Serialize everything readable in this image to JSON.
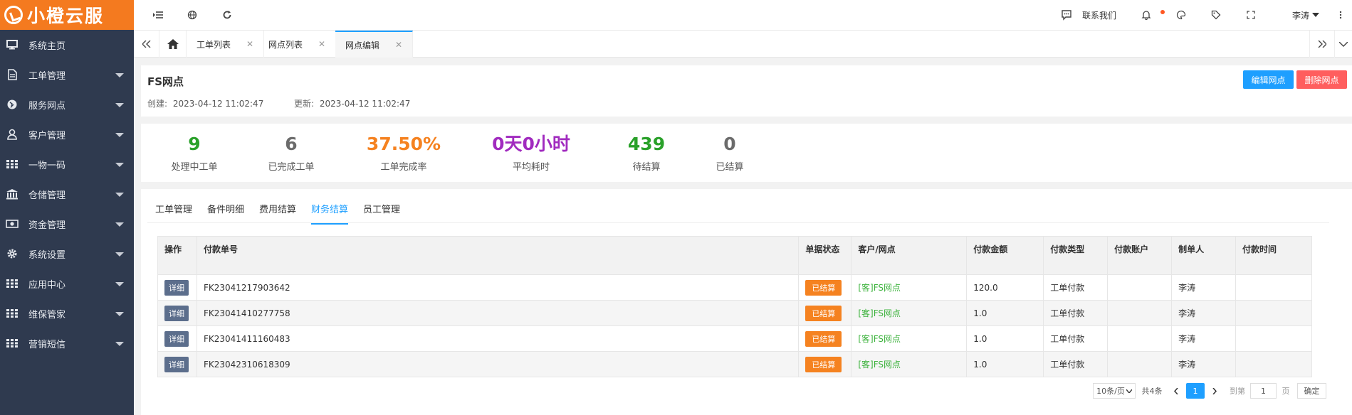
{
  "brand": {
    "name": "小橙云服"
  },
  "sidebar": {
    "items": [
      {
        "label": "系统主页",
        "icon": "monitor-icon",
        "has_arrow": false
      },
      {
        "label": "工单管理",
        "icon": "document-icon",
        "has_arrow": true
      },
      {
        "label": "服务网点",
        "icon": "globe-icon",
        "has_arrow": true
      },
      {
        "label": "客户管理",
        "icon": "user-icon",
        "has_arrow": true
      },
      {
        "label": "一物一码",
        "icon": "grid-icon",
        "has_arrow": true
      },
      {
        "label": "仓储管理",
        "icon": "warehouse-icon",
        "has_arrow": true
      },
      {
        "label": "资金管理",
        "icon": "money-icon",
        "has_arrow": true
      },
      {
        "label": "系统设置",
        "icon": "gear-icon",
        "has_arrow": true
      },
      {
        "label": "应用中心",
        "icon": "grid-icon",
        "has_arrow": true
      },
      {
        "label": "维保管家",
        "icon": "grid-icon",
        "has_arrow": true
      },
      {
        "label": "营销短信",
        "icon": "grid-icon",
        "has_arrow": true
      }
    ]
  },
  "header": {
    "contact_label": "联系我们",
    "user_name": "李涛"
  },
  "tabs": [
    {
      "label": "工单列表"
    },
    {
      "label": "网点列表"
    },
    {
      "label": "网点编辑",
      "active": true
    }
  ],
  "info": {
    "title": "FS网点",
    "created_label": "创建:",
    "created_value": "2023-04-12 11:02:47",
    "updated_label": "更新:",
    "updated_value": "2023-04-12 11:02:47",
    "edit_label": "编辑网点",
    "delete_label": "删除网点",
    "edit_color": "#1e9fff",
    "delete_color": "#ff5e5e"
  },
  "stats": [
    {
      "value": "9",
      "label": "处理中工单",
      "color": "#2aa12a"
    },
    {
      "value": "6",
      "label": "已完成工单",
      "color": "#6b6b6b"
    },
    {
      "value": "37.50%",
      "label": "工单完成率",
      "color": "#f58220"
    },
    {
      "value": "0天0小时",
      "label": "平均耗时",
      "color": "#a12bbf"
    },
    {
      "value": "439",
      "label": "待结算",
      "color": "#2aa12a"
    },
    {
      "value": "0",
      "label": "已结算",
      "color": "#6b6b6b"
    }
  ],
  "sub_tabs": [
    {
      "label": "工单管理"
    },
    {
      "label": "备件明细"
    },
    {
      "label": "费用结算"
    },
    {
      "label": "财务结算",
      "active": true
    },
    {
      "label": "员工管理"
    }
  ],
  "table": {
    "headers": [
      "操作",
      "付款单号",
      "单据状态",
      "客户/网点",
      "付款金额",
      "付款类型",
      "付款账户",
      "制单人",
      "付款时间"
    ],
    "rows": [
      {
        "action": "详细",
        "no": "FK23041217903642",
        "status": "已结算",
        "customer": "[客]FS网点",
        "amount": "120.0",
        "type": "工单付款",
        "account": "",
        "maker": "李涛",
        "time": ""
      },
      {
        "action": "详细",
        "no": "FK23041410277758",
        "status": "已结算",
        "customer": "[客]FS网点",
        "amount": "1.0",
        "type": "工单付款",
        "account": "",
        "maker": "李涛",
        "time": ""
      },
      {
        "action": "详细",
        "no": "FK23041411160483",
        "status": "已结算",
        "customer": "[客]FS网点",
        "amount": "1.0",
        "type": "工单付款",
        "account": "",
        "maker": "李涛",
        "time": ""
      },
      {
        "action": "详细",
        "no": "FK23042310618309",
        "status": "已结算",
        "customer": "[客]FS网点",
        "amount": "1.0",
        "type": "工单付款",
        "account": "",
        "maker": "李涛",
        "time": ""
      }
    ]
  },
  "pagination": {
    "page_size": "10条/页",
    "total": "共4条",
    "current": "1",
    "goto_label": "到第",
    "goto_value": "1",
    "page_unit": "页",
    "confirm_label": "确定",
    "active_color": "#1e9fff"
  }
}
